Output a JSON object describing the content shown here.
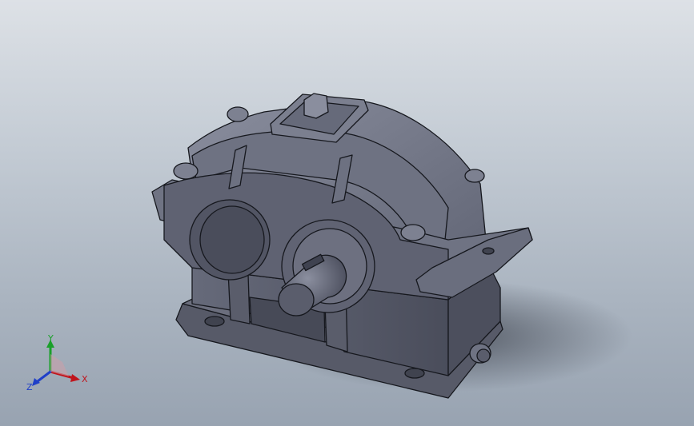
{
  "viewport": {
    "background_top": "#dde1e6",
    "background_bottom": "#98a3b1",
    "model_color": "#5b5e6c",
    "edge_color": "#16181e"
  },
  "model": {
    "kind": "gear-reducer-housing"
  },
  "triad": {
    "x_label": "X",
    "y_label": "Y",
    "z_label": "Z",
    "x_color": "#c0141c",
    "y_color": "#1aa02a",
    "z_color": "#1f3fc8"
  }
}
